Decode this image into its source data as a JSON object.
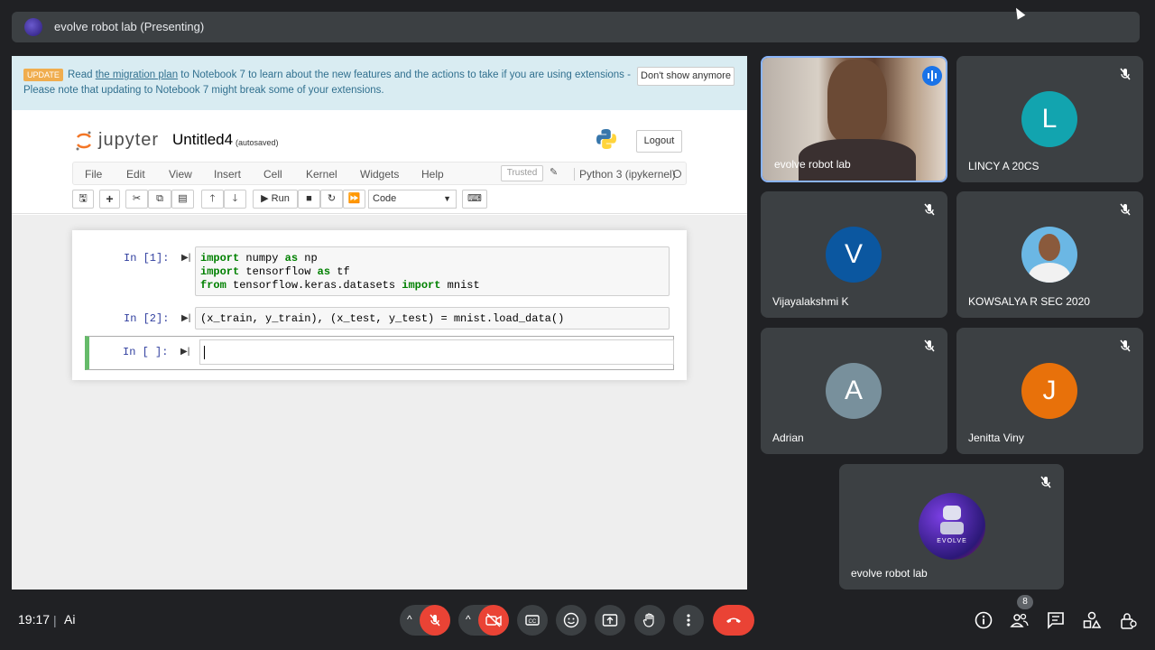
{
  "presenter_bar": {
    "title": "evolve robot lab (Presenting)"
  },
  "notebook": {
    "banner": {
      "badge": "UPDATE",
      "text_a": "Read ",
      "link": "the migration plan",
      "text_b": " to Notebook 7 to learn about the new features and the actions to take if you are using extensions -",
      "line2": "Please note that updating to Notebook 7 might break some of your extensions.",
      "dismiss": "Don't show anymore"
    },
    "logo_text": "jupyter",
    "title": "Untitled4",
    "autosaved": "(autosaved)",
    "logout": "Logout",
    "menu": [
      "File",
      "Edit",
      "View",
      "Insert",
      "Cell",
      "Kernel",
      "Widgets",
      "Help"
    ],
    "trusted": "Trusted",
    "kernel": "Python 3 (ipykernel)",
    "toolbar": {
      "run": "Run",
      "cell_type": "Code"
    },
    "cells": [
      {
        "prompt": "In [1]:",
        "lines": [
          [
            "import",
            " numpy ",
            "as",
            " np"
          ],
          [
            "import",
            " tensorflow ",
            "as",
            " tf"
          ],
          [
            "from",
            " tensorflow.keras.datasets ",
            "import",
            " mnist"
          ]
        ]
      },
      {
        "prompt": "In [2]:",
        "code": "(x_train, y_train), (x_test, y_test) = mnist.load_data()"
      },
      {
        "prompt": "In [ ]:",
        "code": ""
      }
    ]
  },
  "participants": [
    {
      "name": "evolve robot lab",
      "type": "video",
      "speaking": true
    },
    {
      "name": "LINCY A 20CS",
      "initial": "L",
      "color": "#12a4af"
    },
    {
      "name": "Vijayalakshmi K",
      "initial": "V",
      "color": "#0b57a0"
    },
    {
      "name": "KOWSALYA R SEC 2020",
      "type": "photo"
    },
    {
      "name": "Adrian",
      "initial": "A",
      "color": "#78909c"
    },
    {
      "name": "Jenitta Viny",
      "initial": "J",
      "color": "#e8710a"
    },
    {
      "name": "evolve robot lab",
      "type": "logo",
      "logo_text": "EVOLVE"
    }
  ],
  "bottom_bar": {
    "time": "19:17",
    "separator": "|",
    "meeting_code": "Ai",
    "people_count": "8"
  },
  "colors": {
    "background": "#202124",
    "tile": "#3c4043",
    "danger": "#ea4335",
    "speaking": "#8ab4f8"
  }
}
